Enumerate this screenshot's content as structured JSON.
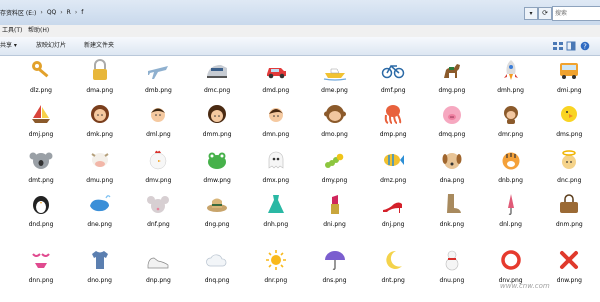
{
  "address_bar": {
    "crumbs": [
      "存资料区 (E:)",
      "QQ",
      "R",
      "f"
    ],
    "search_placeholder": "搜索"
  },
  "menu": {
    "tools": "工具(T)",
    "help": "帮助(H)"
  },
  "toolbar": {
    "share": "共享 ▾",
    "slideshow": "放映幻灯片",
    "new_folder": "新建文件夹"
  },
  "files": [
    {
      "name": "dlz.png",
      "icon": "key-icon"
    },
    {
      "name": "dma.png",
      "icon": "lock-icon"
    },
    {
      "name": "dmb.png",
      "icon": "airplane-icon"
    },
    {
      "name": "dmc.png",
      "icon": "train-icon"
    },
    {
      "name": "dmd.png",
      "icon": "car-icon"
    },
    {
      "name": "dme.png",
      "icon": "speedboat-icon"
    },
    {
      "name": "dmf.png",
      "icon": "bicycle-icon"
    },
    {
      "name": "dmg.png",
      "icon": "horse-icon"
    },
    {
      "name": "dmh.png",
      "icon": "rocket-icon"
    },
    {
      "name": "dmi.png",
      "icon": "bus-icon"
    },
    {
      "name": "dmj.png",
      "icon": "sailboat-icon"
    },
    {
      "name": "dmk.png",
      "icon": "woman-icon"
    },
    {
      "name": "dml.png",
      "icon": "man-icon"
    },
    {
      "name": "dmm.png",
      "icon": "girl-icon"
    },
    {
      "name": "dmn.png",
      "icon": "boy-icon"
    },
    {
      "name": "dmo.png",
      "icon": "monkey-face-icon"
    },
    {
      "name": "dmp.png",
      "icon": "octopus-icon"
    },
    {
      "name": "dmq.png",
      "icon": "pig-icon"
    },
    {
      "name": "dmr.png",
      "icon": "monkey-icon"
    },
    {
      "name": "dms.png",
      "icon": "chick-icon"
    },
    {
      "name": "dmt.png",
      "icon": "koala-icon"
    },
    {
      "name": "dmu.png",
      "icon": "cow-icon"
    },
    {
      "name": "dmv.png",
      "icon": "chicken-icon"
    },
    {
      "name": "dmw.png",
      "icon": "frog-icon"
    },
    {
      "name": "dmx.png",
      "icon": "ghost-icon"
    },
    {
      "name": "dmy.png",
      "icon": "caterpillar-icon"
    },
    {
      "name": "dmz.png",
      "icon": "tropical-fish-icon"
    },
    {
      "name": "dna.png",
      "icon": "dog-icon"
    },
    {
      "name": "dnb.png",
      "icon": "tiger-icon"
    },
    {
      "name": "dnc.png",
      "icon": "angel-icon"
    },
    {
      "name": "dnd.png",
      "icon": "penguin-icon"
    },
    {
      "name": "dne.png",
      "icon": "whale-icon"
    },
    {
      "name": "dnf.png",
      "icon": "mouse-icon"
    },
    {
      "name": "dng.png",
      "icon": "hat-icon"
    },
    {
      "name": "dnh.png",
      "icon": "dress-icon"
    },
    {
      "name": "dni.png",
      "icon": "lipstick-icon"
    },
    {
      "name": "dnj.png",
      "icon": "high-heel-icon"
    },
    {
      "name": "dnk.png",
      "icon": "boot-icon"
    },
    {
      "name": "dnl.png",
      "icon": "umbrella-closed-icon"
    },
    {
      "name": "dnm.png",
      "icon": "handbag-icon"
    },
    {
      "name": "dnn.png",
      "icon": "bikini-icon"
    },
    {
      "name": "dno.png",
      "icon": "shirt-icon"
    },
    {
      "name": "dnp.png",
      "icon": "sneaker-icon"
    },
    {
      "name": "dnq.png",
      "icon": "cloud-icon"
    },
    {
      "name": "dnr.png",
      "icon": "sun-icon"
    },
    {
      "name": "dns.png",
      "icon": "rain-umbrella-icon"
    },
    {
      "name": "dnt.png",
      "icon": "moon-icon"
    },
    {
      "name": "dnu.png",
      "icon": "snowman-icon"
    },
    {
      "name": "dnv.png",
      "icon": "ring-icon"
    },
    {
      "name": "dnw.png",
      "icon": "cross-mark-icon"
    }
  ],
  "watermark": "www.cnw.com"
}
